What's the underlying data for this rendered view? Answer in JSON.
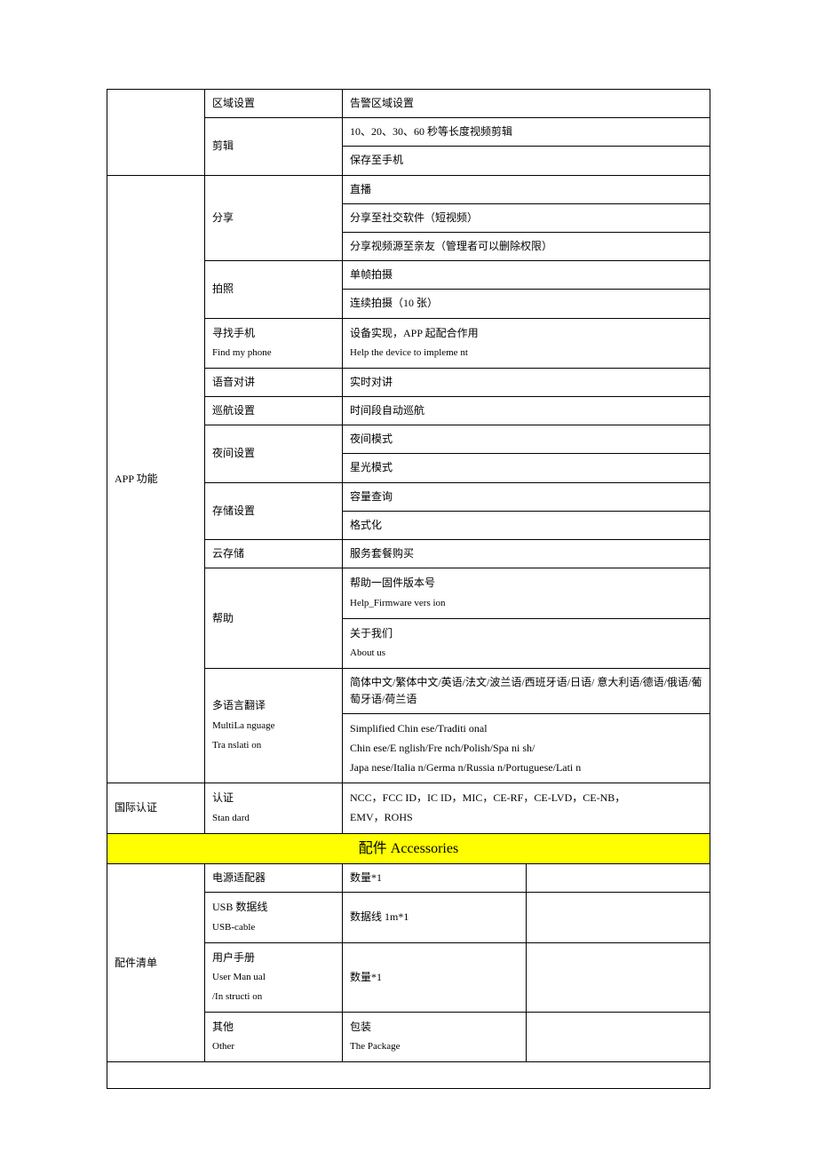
{
  "rows": {
    "r1c2": "区域设置",
    "r1c3": "告警区域设置",
    "r2c2": "剪辑",
    "r2c3a": "10、20、30、60 秒等长度视频剪辑",
    "r2c3b": "保存至手机",
    "r3c2": "分享",
    "r3c3a": "直播",
    "r3c3b": "分享至社交软件（短视频）",
    "r3c3c": "分享视频源至亲友（管理者可以删除权限）",
    "r4c2": "拍照",
    "r4c3a": "单帧拍摄",
    "r4c3b": "连续拍摄（10 张）",
    "r5c2": "寻找手机",
    "r5c2sub": "Find my phone",
    "r5c3": "设备实现，APP 起配合作用",
    "r5c3sub": "Help the device to impleme nt",
    "r6c2": "语音对讲",
    "r6c3": "实时对讲",
    "r7c2": "巡航设置",
    "r7c3": "时间段自动巡航",
    "r8c2": "夜间设置",
    "r8c3a": "夜间模式",
    "r8c3b": "星光模式",
    "appCol": "APP 功能",
    "r9c2": "存储设置",
    "r9c3a": "容量查询",
    "r9c3b": "格式化",
    "r10c2": "云存储",
    "r10c3": "服务套餐购买",
    "r11c2": "帮助",
    "r11c3a": "帮助一固件版本号",
    "r11c3asub": "Help_Firmware vers ion",
    "r11c3b": "关于我们",
    "r11c3bsub": "About us",
    "r12c2": "多语言翻译",
    "r12c2sub1": "MultiLa nguage",
    "r12c2sub2": "Tra nslati on",
    "r12c3a": "简体中文/繁体中文/英语/法文/波兰语/西班牙语/日语/ 意大利语/德语/俄语/葡萄牙语/荷兰语",
    "r12c3b": "Simplified Chin ese/Traditi onal",
    "r12c3c": "Chin ese/E nglish/Fre nch/Polish/Spa ni sh/",
    "r12c3d": "Japa nese/Italia n/Germa n/Russia n/Portuguese/Lati n",
    "intlCol": "国际认证",
    "r13c2": "认证",
    "r13c2sub": "Stan dard",
    "r13c3a": "NCC，FCC ID，IC ID，MIC，CE-RF，CE-LVD，CE-NB，",
    "r13c3b": "EMV，ROHS",
    "sectionHeader": "配件 Accessories",
    "accCol": "配件清单",
    "r14c2": "电源适配器",
    "r14c3": "数量*1",
    "r15c2": "USB 数据线",
    "r15c2sub": "USB-cable",
    "r15c3": "数据线 1m*1",
    "r16c2": "用户手册",
    "r16c2sub1": "User Man ual",
    "r16c2sub2": "/In structi on",
    "r16c3": "数量*1",
    "r17c2": "其他",
    "r17c2sub": "Other",
    "r17c3": "包装",
    "r17c3sub": "The Package"
  }
}
